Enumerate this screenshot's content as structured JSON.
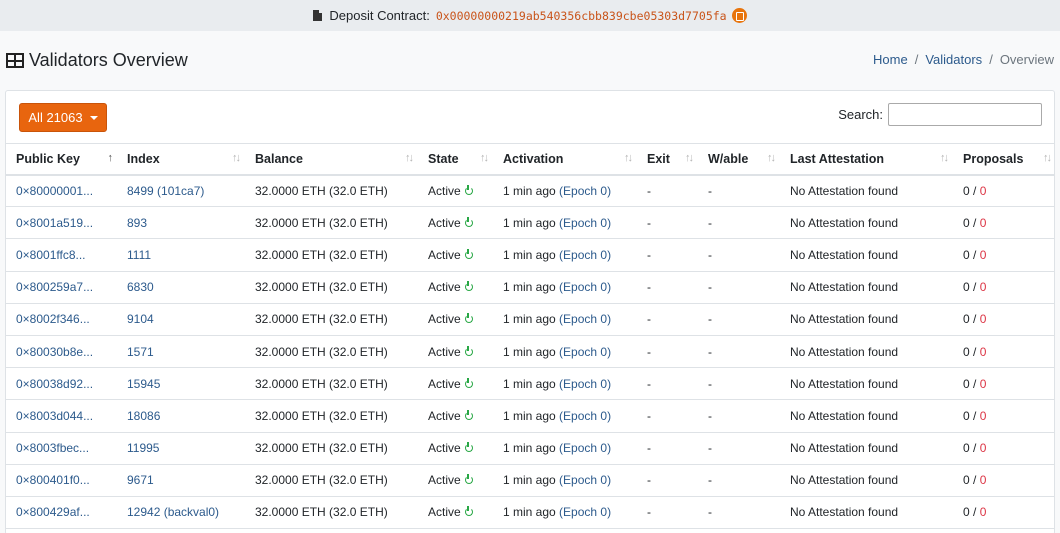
{
  "topbar": {
    "label": "Deposit Contract:",
    "address": "0x00000000219ab540356cbb839cbe05303d7705fa"
  },
  "page": {
    "title": "Validators Overview"
  },
  "breadcrumb": [
    "Home",
    "Validators",
    "Overview"
  ],
  "filter": {
    "label": "All 21063"
  },
  "search": {
    "label": "Search:",
    "value": ""
  },
  "columns": [
    "Public Key",
    "Index",
    "Balance",
    "State",
    "Activation",
    "Exit",
    "W/able",
    "Last Attestation",
    "Proposals"
  ],
  "rows": [
    {
      "pubkey": "0×80000001...",
      "index": "8499 (101ca7)",
      "balance": "32.0000 ETH (32.0 ETH)",
      "state": "Active",
      "activation": "1 min ago",
      "epoch": "(Epoch 0)",
      "exit": "-",
      "wable": "-",
      "attestation": "No Attestation found",
      "p1": "0",
      "p2": "0"
    },
    {
      "pubkey": "0×8001a519...",
      "index": "893",
      "balance": "32.0000 ETH (32.0 ETH)",
      "state": "Active",
      "activation": "1 min ago",
      "epoch": "(Epoch 0)",
      "exit": "-",
      "wable": "-",
      "attestation": "No Attestation found",
      "p1": "0",
      "p2": "0"
    },
    {
      "pubkey": "0×8001ffc8...",
      "index": "1111",
      "balance": "32.0000 ETH (32.0 ETH)",
      "state": "Active",
      "activation": "1 min ago",
      "epoch": "(Epoch 0)",
      "exit": "-",
      "wable": "-",
      "attestation": "No Attestation found",
      "p1": "0",
      "p2": "0"
    },
    {
      "pubkey": "0×800259a7...",
      "index": "6830",
      "balance": "32.0000 ETH (32.0 ETH)",
      "state": "Active",
      "activation": "1 min ago",
      "epoch": "(Epoch 0)",
      "exit": "-",
      "wable": "-",
      "attestation": "No Attestation found",
      "p1": "0",
      "p2": "0"
    },
    {
      "pubkey": "0×8002f346...",
      "index": "9104",
      "balance": "32.0000 ETH (32.0 ETH)",
      "state": "Active",
      "activation": "1 min ago",
      "epoch": "(Epoch 0)",
      "exit": "-",
      "wable": "-",
      "attestation": "No Attestation found",
      "p1": "0",
      "p2": "0"
    },
    {
      "pubkey": "0×80030b8e...",
      "index": "1571",
      "balance": "32.0000 ETH (32.0 ETH)",
      "state": "Active",
      "activation": "1 min ago",
      "epoch": "(Epoch 0)",
      "exit": "-",
      "wable": "-",
      "attestation": "No Attestation found",
      "p1": "0",
      "p2": "0"
    },
    {
      "pubkey": "0×80038d92...",
      "index": "15945",
      "balance": "32.0000 ETH (32.0 ETH)",
      "state": "Active",
      "activation": "1 min ago",
      "epoch": "(Epoch 0)",
      "exit": "-",
      "wable": "-",
      "attestation": "No Attestation found",
      "p1": "0",
      "p2": "0"
    },
    {
      "pubkey": "0×8003d044...",
      "index": "18086",
      "balance": "32.0000 ETH (32.0 ETH)",
      "state": "Active",
      "activation": "1 min ago",
      "epoch": "(Epoch 0)",
      "exit": "-",
      "wable": "-",
      "attestation": "No Attestation found",
      "p1": "0",
      "p2": "0"
    },
    {
      "pubkey": "0×8003fbec...",
      "index": "11995",
      "balance": "32.0000 ETH (32.0 ETH)",
      "state": "Active",
      "activation": "1 min ago",
      "epoch": "(Epoch 0)",
      "exit": "-",
      "wable": "-",
      "attestation": "No Attestation found",
      "p1": "0",
      "p2": "0"
    },
    {
      "pubkey": "0×800401f0...",
      "index": "9671",
      "balance": "32.0000 ETH (32.0 ETH)",
      "state": "Active",
      "activation": "1 min ago",
      "epoch": "(Epoch 0)",
      "exit": "-",
      "wable": "-",
      "attestation": "No Attestation found",
      "p1": "0",
      "p2": "0"
    },
    {
      "pubkey": "0×800429af...",
      "index": "12942 (backval0)",
      "balance": "32.0000 ETH (32.0 ETH)",
      "state": "Active",
      "activation": "1 min ago",
      "epoch": "(Epoch 0)",
      "exit": "-",
      "wable": "-",
      "attestation": "No Attestation found",
      "p1": "0",
      "p2": "0"
    }
  ],
  "colors": {
    "accent": "#e8650e",
    "link": "#2c5a8c",
    "active": "#28a745",
    "danger": "#dc3545"
  }
}
